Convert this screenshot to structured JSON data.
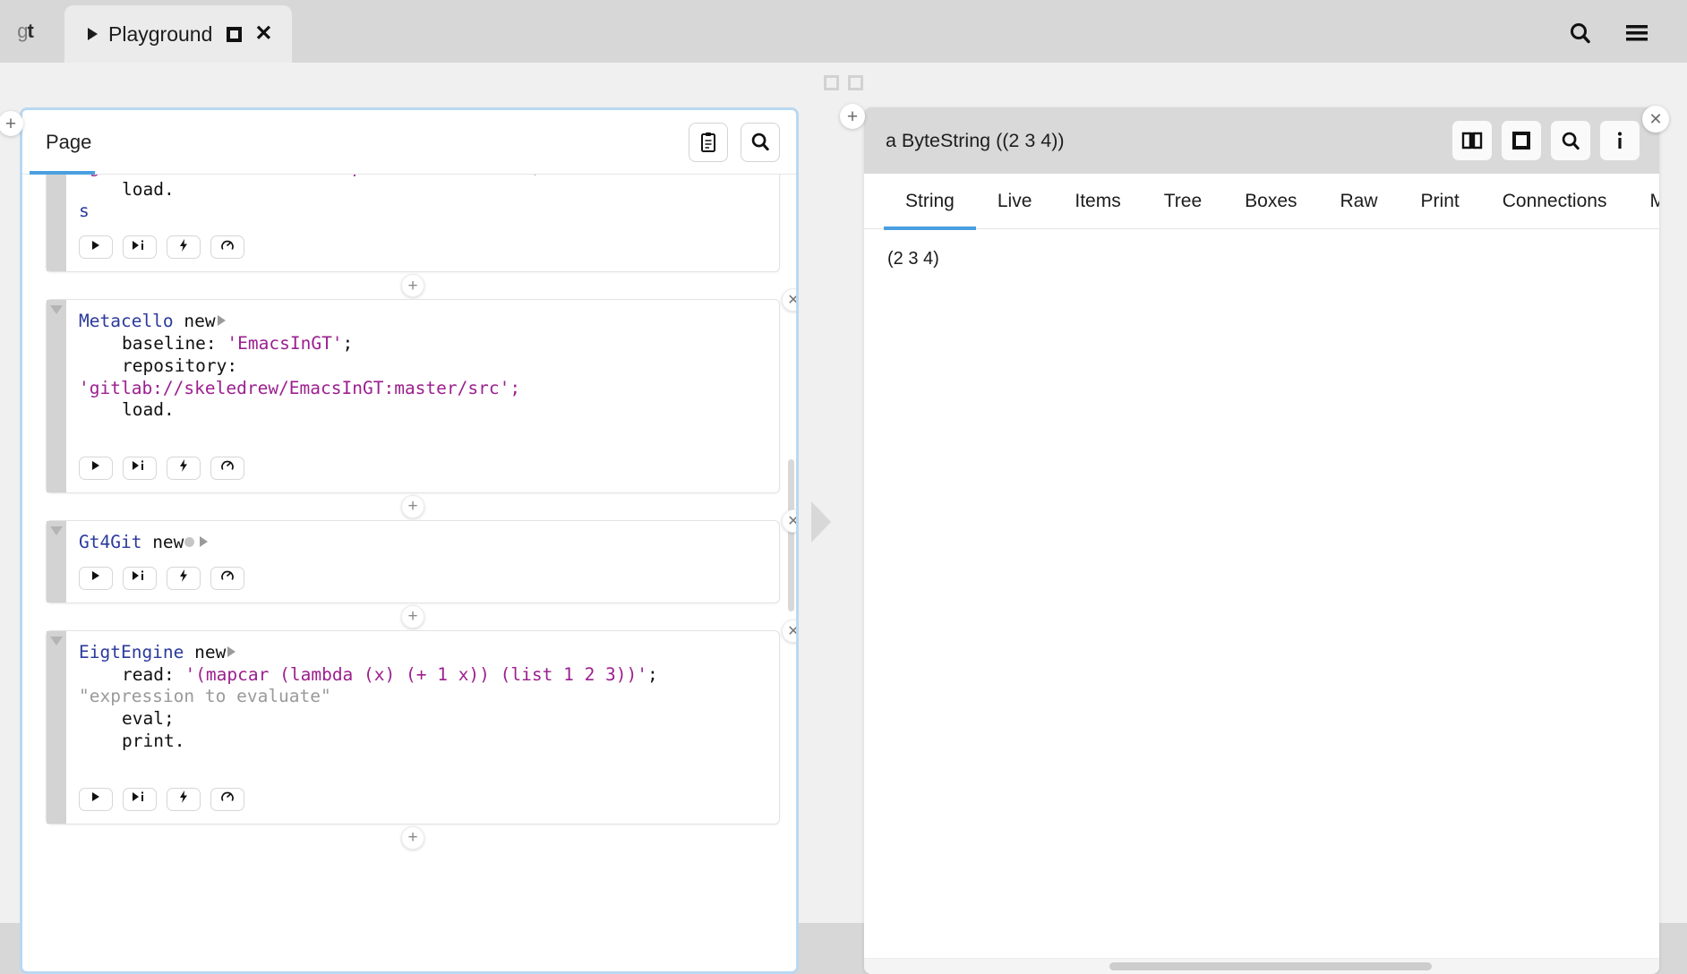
{
  "titlebar": {
    "logo_g": "g",
    "logo_t": "t",
    "tab_label": "Playground",
    "tab_caret_icon": "play-triangle-icon",
    "tab_maximize_icon": "square-icon",
    "tab_close_icon": "close-x-icon",
    "search_icon": "search-icon",
    "menu_icon": "hamburger-menu-icon"
  },
  "left_panel": {
    "tab_label": "Page",
    "header_buttons": [
      {
        "name": "clipboard-button",
        "icon": "clipboard-icon"
      },
      {
        "name": "search-button",
        "icon": "search-icon"
      }
    ],
    "add_handle": "+",
    "snippet_toolbar_icons": [
      "play-icon",
      "play-inspect-icon",
      "lightning-bolt-icon",
      "profiler-gauge-icon"
    ],
    "snippets": [
      {
        "id": "snippet-1",
        "closable": false,
        "lines": [
          {
            "indent": 1,
            "parts": [
              {
                "t": "repository:",
                "c": "plain"
              }
            ]
          },
          {
            "indent": 0,
            "parts": [
              {
                "t": "'gitlab://skeledrew/GtExemplifierAdditions';",
                "c": "str"
              }
            ]
          },
          {
            "indent": 1,
            "parts": [
              {
                "t": "load.",
                "c": "plain"
              }
            ]
          },
          {
            "indent": 0,
            "parts": [
              {
                "t": "s",
                "c": "cls"
              }
            ]
          }
        ]
      },
      {
        "id": "snippet-2",
        "closable": true,
        "lines": [
          {
            "indent": 0,
            "parts": [
              {
                "t": "Metacello",
                "c": "cls"
              },
              {
                "t": " new",
                "c": "plain"
              },
              {
                "t": "",
                "c": "arrow"
              }
            ]
          },
          {
            "indent": 1,
            "parts": [
              {
                "t": "baseline: ",
                "c": "plain"
              },
              {
                "t": "'EmacsInGT'",
                "c": "str"
              },
              {
                "t": ";",
                "c": "plain"
              }
            ]
          },
          {
            "indent": 1,
            "parts": [
              {
                "t": "repository:",
                "c": "plain"
              }
            ]
          },
          {
            "indent": 0,
            "parts": [
              {
                "t": "'gitlab://skeledrew/EmacsInGT:master/src';",
                "c": "str"
              }
            ]
          },
          {
            "indent": 1,
            "parts": [
              {
                "t": "load.",
                "c": "plain"
              }
            ]
          },
          {
            "indent": 0,
            "parts": [
              {
                "t": "",
                "c": "plain"
              }
            ]
          }
        ]
      },
      {
        "id": "snippet-3",
        "closable": true,
        "lines": [
          {
            "indent": 0,
            "parts": [
              {
                "t": "Gt4Git",
                "c": "cls"
              },
              {
                "t": " new",
                "c": "plain"
              },
              {
                "t": "",
                "c": "dot"
              },
              {
                "t": "",
                "c": "arrow"
              }
            ]
          }
        ]
      },
      {
        "id": "snippet-4",
        "closable": true,
        "lines": [
          {
            "indent": 0,
            "parts": [
              {
                "t": "EigtEngine",
                "c": "cls"
              },
              {
                "t": " new",
                "c": "plain"
              },
              {
                "t": "",
                "c": "arrow"
              }
            ]
          },
          {
            "indent": 1,
            "parts": [
              {
                "t": "read: ",
                "c": "plain"
              },
              {
                "t": "'(mapcar (lambda (x) (+ 1 x)) (list 1 2 3))'",
                "c": "str"
              },
              {
                "t": ";",
                "c": "plain"
              }
            ]
          },
          {
            "indent": 0,
            "parts": [
              {
                "t": "\"expression to evaluate\"",
                "c": "cmt"
              }
            ]
          },
          {
            "indent": 1,
            "parts": [
              {
                "t": "eval;",
                "c": "plain"
              }
            ]
          },
          {
            "indent": 1,
            "parts": [
              {
                "t": "print.",
                "c": "plain"
              }
            ]
          },
          {
            "indent": 0,
            "parts": [
              {
                "t": "",
                "c": "plain"
              }
            ]
          }
        ]
      }
    ]
  },
  "right_panel": {
    "title": "a ByteString ((2 3 4))",
    "add_handle": "+",
    "close_icon": "close-x-icon",
    "header_buttons": [
      {
        "name": "book-button",
        "icon": "book-icon"
      },
      {
        "name": "square-button",
        "icon": "square-icon"
      },
      {
        "name": "search-button",
        "icon": "search-icon"
      },
      {
        "name": "info-button",
        "icon": "info-icon"
      }
    ],
    "tabs": [
      {
        "label": "String",
        "active": true
      },
      {
        "label": "Live",
        "active": false
      },
      {
        "label": "Items",
        "active": false
      },
      {
        "label": "Tree",
        "active": false
      },
      {
        "label": "Boxes",
        "active": false
      },
      {
        "label": "Raw",
        "active": false
      },
      {
        "label": "Print",
        "active": false
      },
      {
        "label": "Connections",
        "active": false
      },
      {
        "label": "Meta",
        "active": false
      }
    ],
    "content": "(2 3 4)"
  },
  "colors": {
    "accent_blue": "#4a9fe0",
    "panel_border_blue": "#b9d8f2",
    "class_name": "#2b3a9c",
    "string_literal": "#9c1f8f",
    "comment": "#9a9a9a",
    "titlebar_bg": "#d7d7d7",
    "workspace_bg": "#f0f0f0",
    "inspector_header_bg": "#d9d9d9"
  }
}
